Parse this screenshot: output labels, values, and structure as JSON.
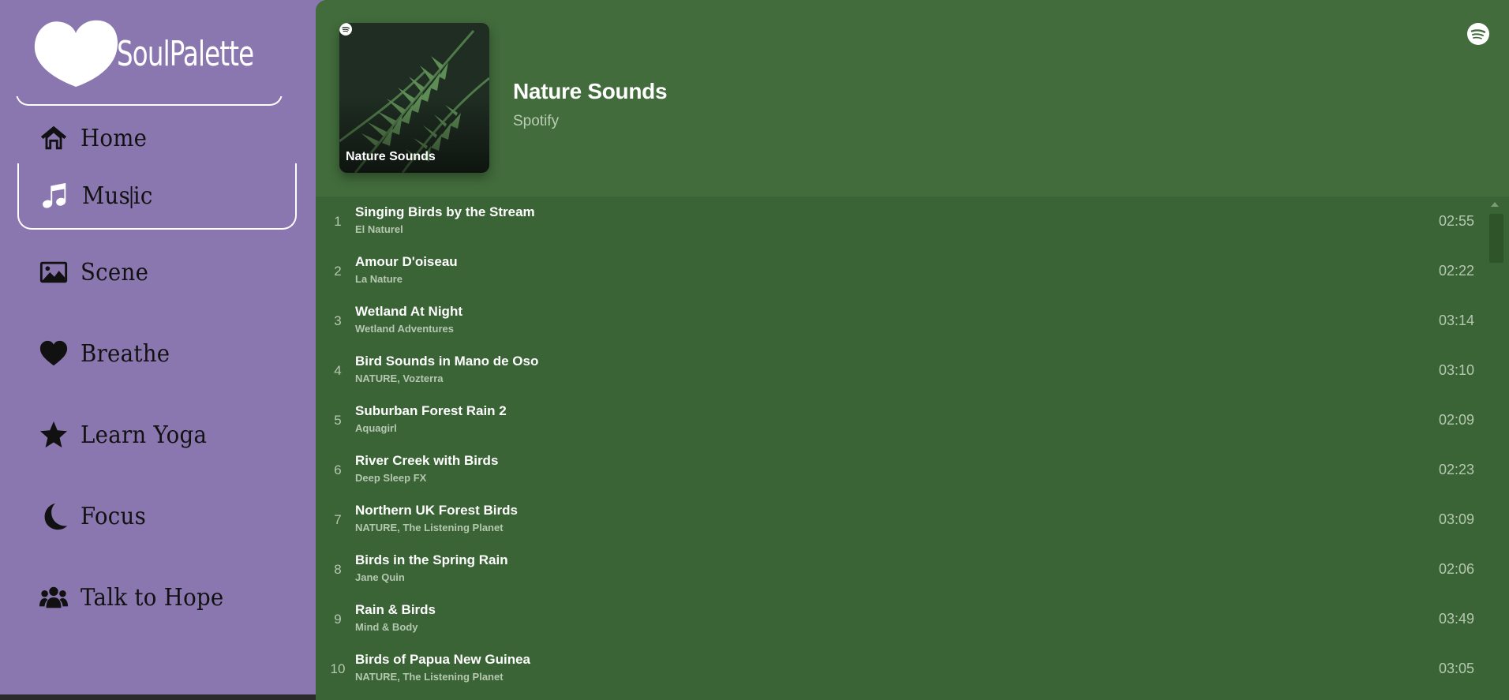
{
  "brand": {
    "name": "SoulPalette",
    "logo_icon": "heart-icon"
  },
  "nav": {
    "items": [
      {
        "label": "Home",
        "icon": "home-icon"
      },
      {
        "label_before": "Mus",
        "label_after": "ic",
        "label": "Music",
        "icon": "music-note-icon",
        "active": true
      },
      {
        "label": "Scene",
        "icon": "image-icon"
      },
      {
        "label": "Breathe",
        "icon": "heart-icon"
      },
      {
        "label": "Learn Yoga",
        "icon": "star-icon"
      },
      {
        "label": "Focus",
        "icon": "moon-icon"
      },
      {
        "label": "Talk to Hope",
        "icon": "users-icon"
      }
    ]
  },
  "player": {
    "cover_title": "Nature Sounds",
    "title": "Nature Sounds",
    "owner": "Spotify",
    "bg_color": "#426c3c",
    "tracks": [
      {
        "num": "1",
        "name": "Singing Birds by the Stream",
        "artist": "El Naturel",
        "duration": "02:55"
      },
      {
        "num": "2",
        "name": "Amour D'oiseau",
        "artist": "La Nature",
        "duration": "02:22"
      },
      {
        "num": "3",
        "name": "Wetland At Night",
        "artist": "Wetland Adventures",
        "duration": "03:14"
      },
      {
        "num": "4",
        "name": "Bird Sounds in Mano de Oso",
        "artist": "NATURE, Vozterra",
        "duration": "03:10"
      },
      {
        "num": "5",
        "name": "Suburban Forest Rain 2",
        "artist": "Aquagirl",
        "duration": "02:09"
      },
      {
        "num": "6",
        "name": "River Creek with Birds",
        "artist": "Deep Sleep FX",
        "duration": "02:23"
      },
      {
        "num": "7",
        "name": "Northern UK Forest Birds",
        "artist": "NATURE, The Listening Planet",
        "duration": "03:09"
      },
      {
        "num": "8",
        "name": "Birds in the Spring Rain",
        "artist": "Jane Quin",
        "duration": "02:06"
      },
      {
        "num": "9",
        "name": "Rain & Birds",
        "artist": "Mind & Body",
        "duration": "03:49"
      },
      {
        "num": "10",
        "name": "Birds of Papua New Guinea",
        "artist": "NATURE, The Listening Planet",
        "duration": "03:05"
      }
    ]
  }
}
